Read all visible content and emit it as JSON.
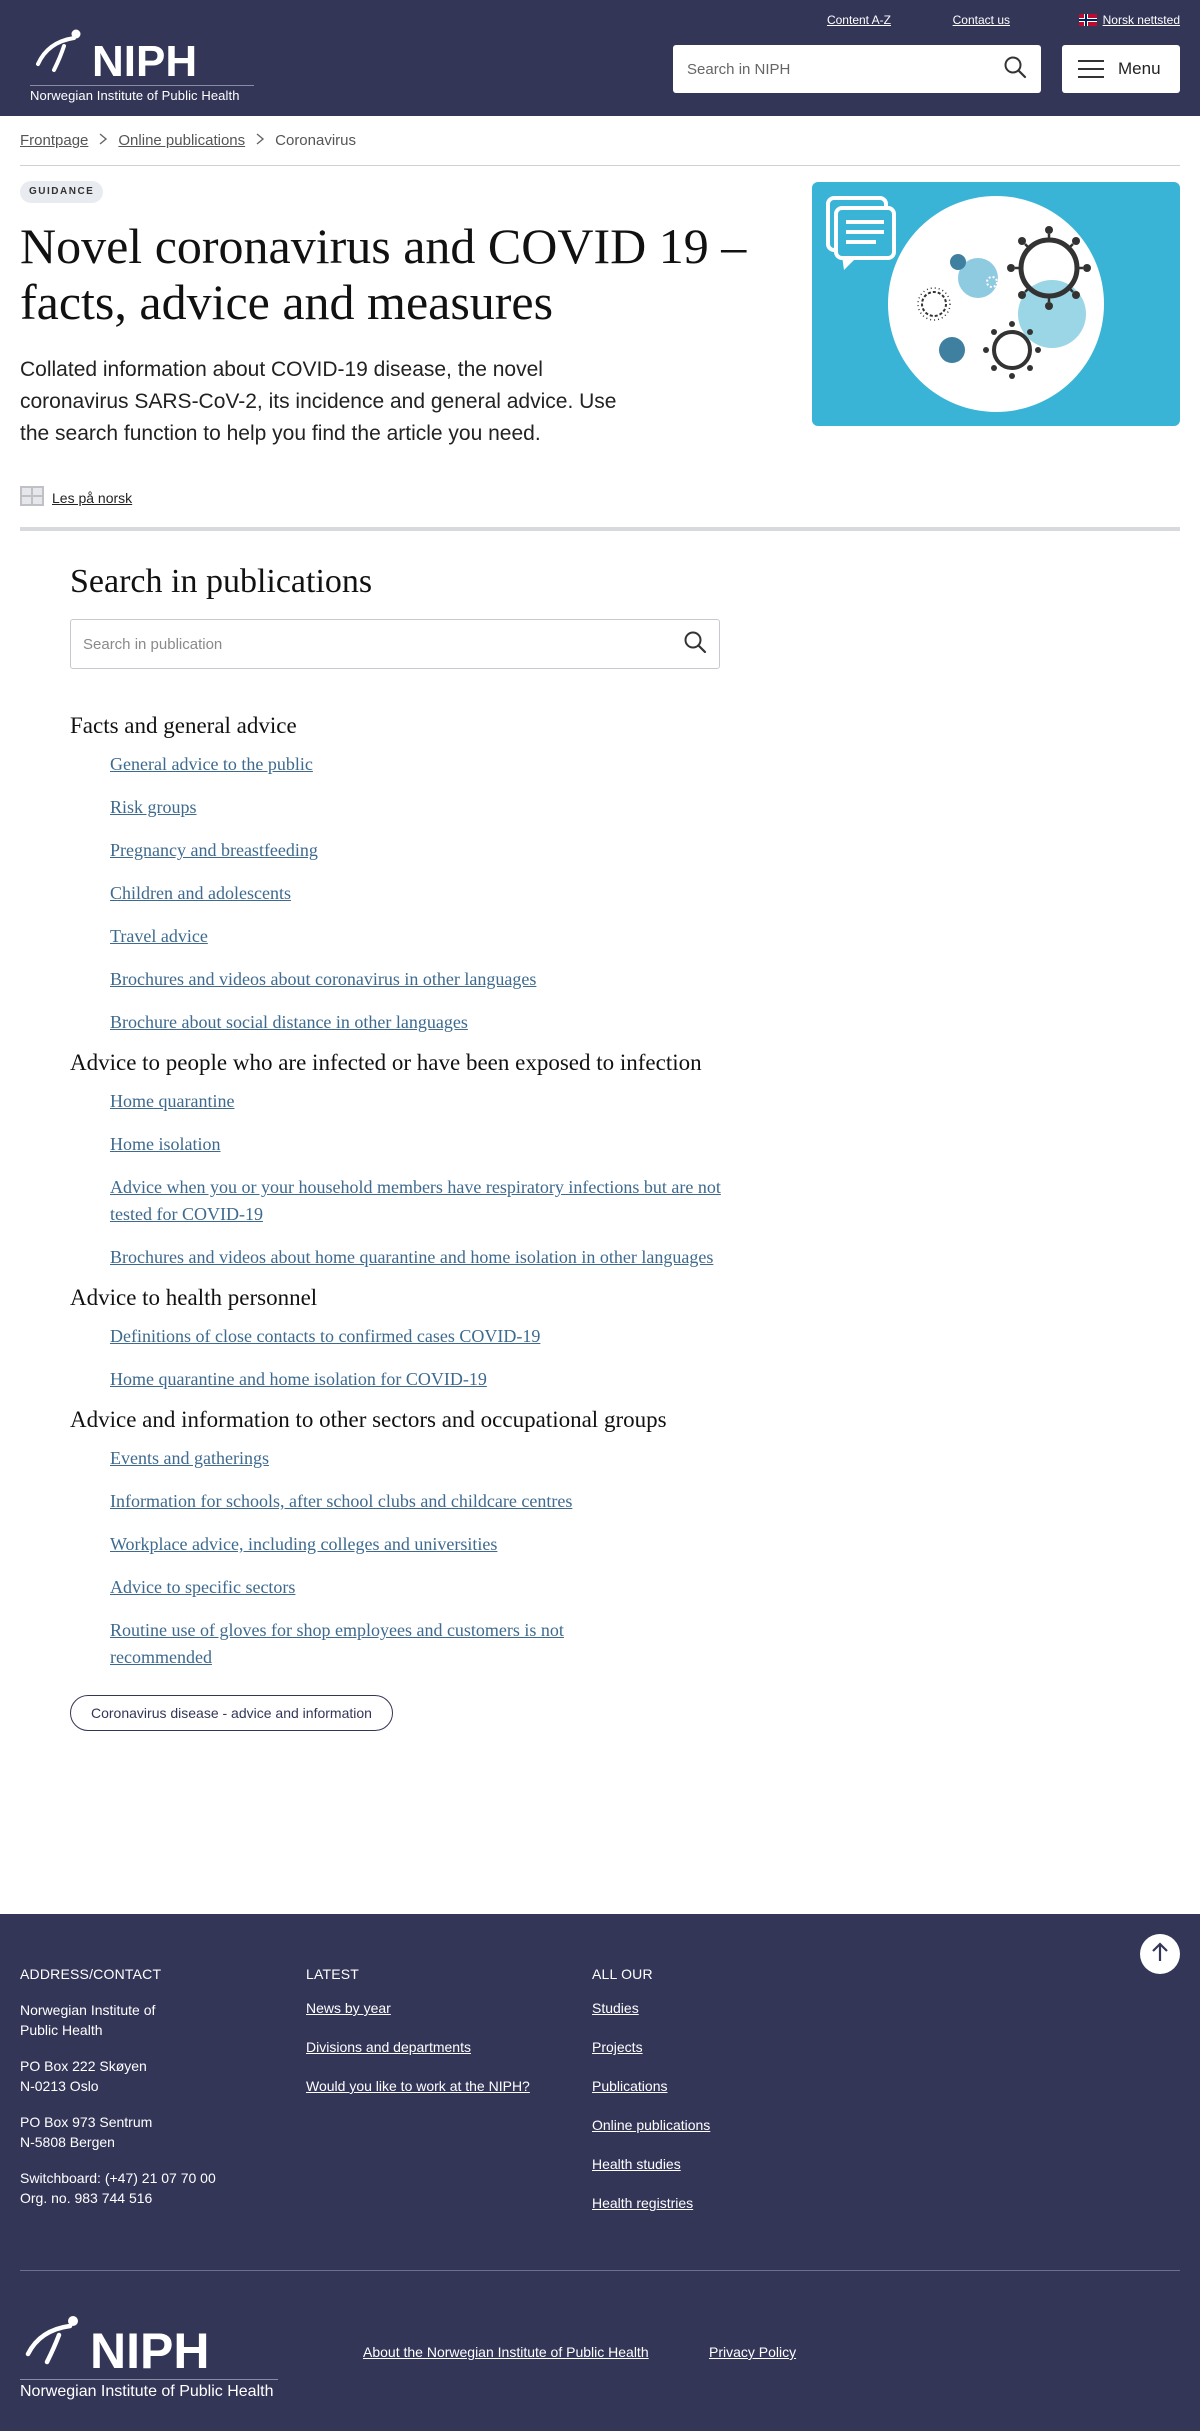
{
  "header": {
    "logo_text": "NIPH",
    "logo_subtitle": "Norwegian Institute of Public Health",
    "links": {
      "content_az": "Content A-Z",
      "contact": "Contact us",
      "norsk": "Norsk nettsted"
    },
    "search_placeholder": "Search in NIPH",
    "menu_label": "Menu",
    "colors": {
      "background": "#343658"
    }
  },
  "breadcrumb": [
    "Frontpage",
    "Online publications",
    "Coronavirus"
  ],
  "hero": {
    "badge": "GUIDANCE",
    "title": "Novel coronavirus and COVID 19 – facts, advice and measures",
    "lead": "Collated information about COVID-19 disease, the novel coronavirus SARS-CoV-2, its incidence and general advice. Use the search function to help you find the article you need.",
    "language_link": "Les på norsk",
    "image_color": "#3ab4d6"
  },
  "search_publications": {
    "heading": "Search in publications",
    "placeholder": "Search in publication"
  },
  "sections": [
    {
      "heading": "Facts and general advice",
      "links": [
        "General advice to the public",
        "Risk groups",
        "Pregnancy and breastfeeding",
        "Children and adolescents",
        "Travel advice",
        "Brochures and videos about coronavirus in other languages",
        "Brochure about social distance in other languages"
      ]
    },
    {
      "heading": "Advice to people who are infected or have been exposed to infection",
      "links": [
        "Home quarantine",
        "Home isolation",
        "Advice when you or your household members have respiratory infections but are not tested for COVID-19",
        "Brochures and videos about home quarantine and home isolation in other languages"
      ]
    },
    {
      "heading": "Advice to health personnel",
      "links": [
        "Definitions of close contacts to confirmed cases  COVID-19",
        "Home quarantine and home isolation for COVID-19"
      ]
    },
    {
      "heading": "Advice and information to other sectors and occupational groups",
      "links": [
        "Events and gatherings",
        "Information for schools, after school clubs and childcare centres",
        "Workplace advice, including colleges and universities",
        "Advice to specific sectors",
        "Routine use of gloves for shop employees and customers is not recommended"
      ]
    }
  ],
  "bottom_button": "Coronavirus disease - advice and information",
  "footer": {
    "address": {
      "heading": "ADDRESS/CONTACT",
      "name_line1": "Norwegian Institute of",
      "name_line2": "Public Health",
      "box1_line1": "PO Box 222 Skøyen",
      "box1_line2": "N-0213 Oslo",
      "box2_line1": "PO Box 973 Sentrum",
      "box2_line2": "N-5808 Bergen",
      "switchboard": "Switchboard: (+47) 21 07 70 00",
      "org_no": "Org. no. 983 744 516"
    },
    "latest": {
      "heading": "LATEST",
      "links": [
        "News by year",
        "Divisions and departments",
        "Would you like to work at the NIPH?"
      ]
    },
    "all_our": {
      "heading": "ALL OUR",
      "links": [
        "Studies",
        "Projects",
        "Publications",
        "Online publications",
        "Health studies",
        "Health registries"
      ]
    },
    "logo_text": "NIPH",
    "logo_subtitle": "Norwegian Institute of Public Health",
    "bottom_links": [
      "About the Norwegian Institute of Public Health",
      "Privacy Policy"
    ]
  }
}
